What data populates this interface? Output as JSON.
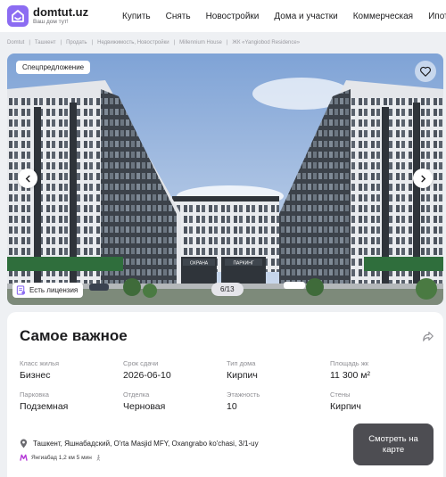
{
  "header": {
    "logo_name": "domtut.uz",
    "logo_tagline": "Ваш дом тут!",
    "nav": [
      "Купить",
      "Снять",
      "Новостройки",
      "Дома и участки",
      "Коммерческая",
      "Ипотека"
    ]
  },
  "breadcrumb": [
    "Domtut",
    "Ташкент",
    "Продать",
    "Недвижимость, Новостройки",
    "Millennium House",
    "ЖК «Yangiobod Residence»"
  ],
  "gallery": {
    "offer_badge": "Спецпредложение",
    "license_label": "Есть лицензия",
    "counter": "6/13",
    "sign_left": "ОХРАНА",
    "sign_right": "ПАРКИНГ"
  },
  "main": {
    "title": "Самое важное",
    "specs": [
      {
        "label": "Класс жилья",
        "value": "Бизнес"
      },
      {
        "label": "Срок сдачи",
        "value": "2026-06-10"
      },
      {
        "label": "Тип дома",
        "value": "Кирпич"
      },
      {
        "label": "Площадь жк",
        "value": "11 300 м²"
      },
      {
        "label": "Парковка",
        "value": "Подземная"
      },
      {
        "label": "Отделка",
        "value": "Черновая"
      },
      {
        "label": "Этажность",
        "value": "10"
      },
      {
        "label": "Стены",
        "value": "Кирпич"
      }
    ],
    "address": "Ташкент, Яшнабадский, O'rta Masjid MFY, Oxangrabo ko'chasi, 3/1-uy",
    "metro": {
      "station": "Янгиабад",
      "distance": "1,2 км",
      "time": "5 мин"
    },
    "map_button": "Смотреть на карте"
  },
  "colors": {
    "brand": "#8c6cf2",
    "metro": "#b53bd8",
    "map_button": "#4d4d52"
  }
}
